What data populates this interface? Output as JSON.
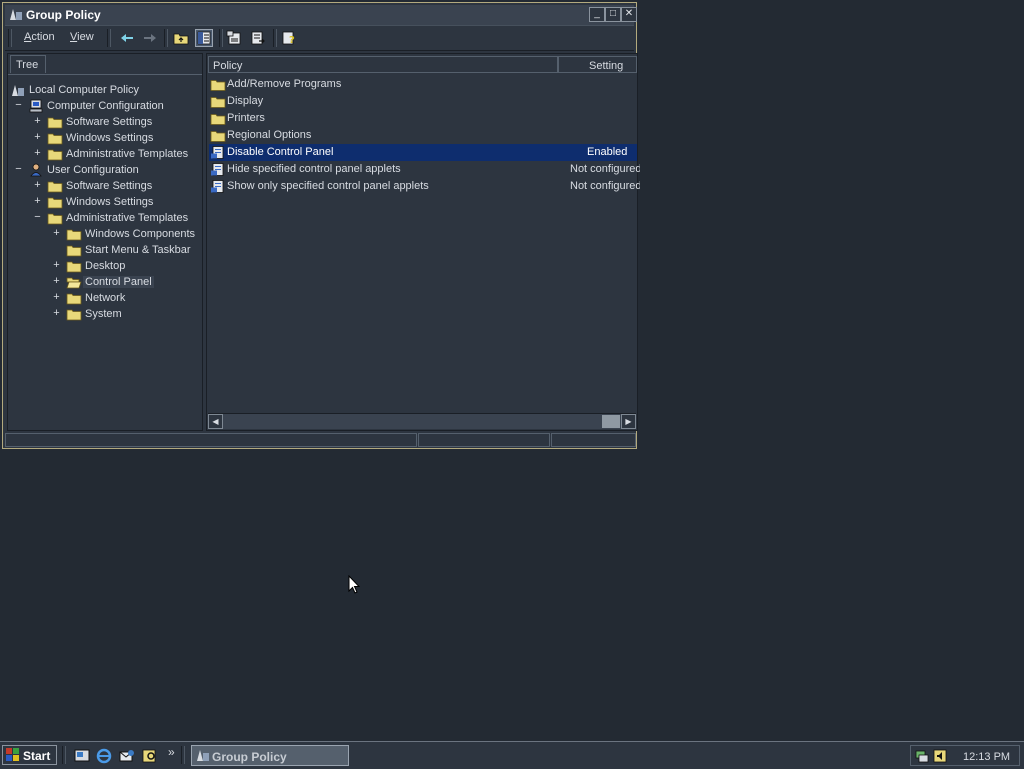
{
  "window": {
    "title": "Group Policy",
    "buttons": {
      "minimize": "_",
      "maximize": "□",
      "close": "✕"
    }
  },
  "menu": {
    "action": {
      "ul": "A",
      "rest": "ction"
    },
    "view": {
      "ul": "V",
      "rest": "iew"
    }
  },
  "toolbar": {
    "icons": [
      "back-arrow-icon",
      "forward-arrow-icon",
      "up-folder-icon",
      "show-hide-tree-icon",
      "properties-icon",
      "export-list-icon",
      "help-icon"
    ]
  },
  "tree": {
    "tab_label": "Tree",
    "nodes": [
      {
        "label": "Local Computer Policy",
        "expander": "",
        "icon": "policy-icon"
      },
      {
        "label": "Computer Configuration",
        "expander": "−",
        "icon": "computer-icon"
      },
      {
        "label": "Software Settings",
        "expander": "+",
        "icon": "folder-icon"
      },
      {
        "label": "Windows Settings",
        "expander": "+",
        "icon": "folder-icon"
      },
      {
        "label": "Administrative Templates",
        "expander": "+",
        "icon": "folder-icon"
      },
      {
        "label": "User Configuration",
        "expander": "−",
        "icon": "user-icon"
      },
      {
        "label": "Software Settings",
        "expander": "+",
        "icon": "folder-icon"
      },
      {
        "label": "Windows Settings",
        "expander": "+",
        "icon": "folder-icon"
      },
      {
        "label": "Administrative Templates",
        "expander": "−",
        "icon": "folder-icon"
      },
      {
        "label": "Windows Components",
        "expander": "+",
        "icon": "folder-icon"
      },
      {
        "label": "Start Menu & Taskbar",
        "expander": "",
        "icon": "folder-icon"
      },
      {
        "label": "Desktop",
        "expander": "+",
        "icon": "folder-icon"
      },
      {
        "label": "Control Panel",
        "expander": "+",
        "icon": "open-folder-icon"
      },
      {
        "label": "Network",
        "expander": "+",
        "icon": "folder-icon"
      },
      {
        "label": "System",
        "expander": "+",
        "icon": "folder-icon"
      }
    ]
  },
  "list": {
    "columns": {
      "policy": "Policy",
      "setting": "Setting"
    },
    "rows": [
      {
        "name": "Add/Remove Programs",
        "setting": "",
        "icon": "folder-icon"
      },
      {
        "name": "Display",
        "setting": "",
        "icon": "folder-icon"
      },
      {
        "name": "Printers",
        "setting": "",
        "icon": "folder-icon"
      },
      {
        "name": "Regional Options",
        "setting": "",
        "icon": "folder-icon"
      },
      {
        "name": "Disable Control Panel",
        "setting": "Enabled",
        "icon": "policy-setting-icon"
      },
      {
        "name": "Hide specified control panel applets",
        "setting": "Not configured",
        "icon": "policy-setting-icon"
      },
      {
        "name": "Show only specified control panel applets",
        "setting": "Not configured",
        "icon": "policy-setting-icon"
      }
    ]
  },
  "taskbar": {
    "start_label": "Start",
    "task_label": "Group Policy",
    "overflow": "»",
    "clock": "12:13 PM",
    "quick_launch": [
      "show-desktop-icon",
      "internet-explorer-icon",
      "outlook-express-icon",
      "search-icon"
    ],
    "tray_icons": [
      "network-icon",
      "volume-icon"
    ]
  },
  "colors": {
    "desktop": "#232a33",
    "selection": "#0e2d6e",
    "window_border": "#b3aa7e"
  }
}
